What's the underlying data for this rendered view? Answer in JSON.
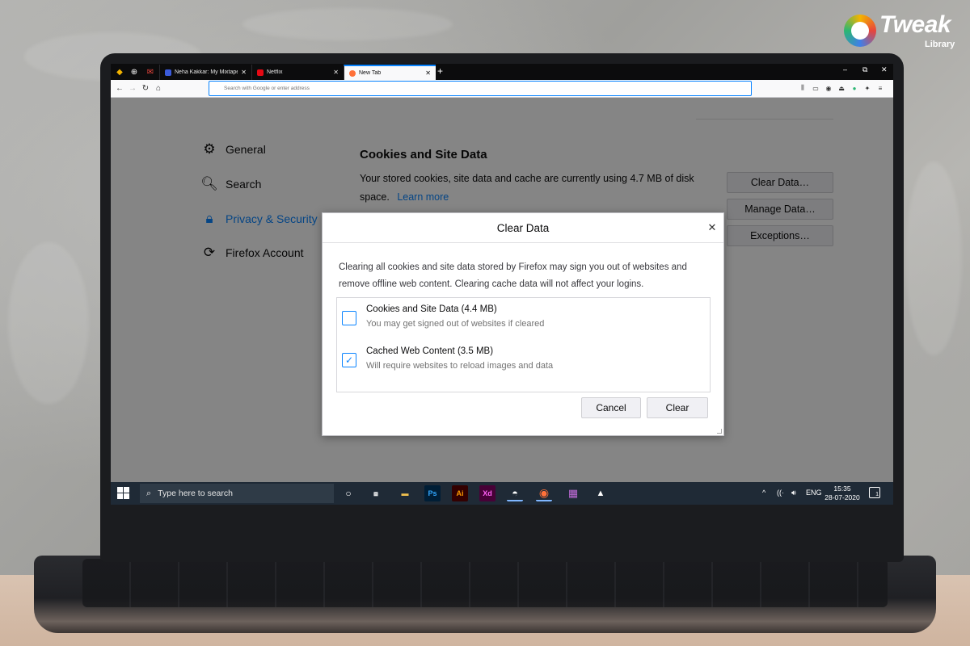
{
  "brand": {
    "name": "Tweak",
    "sub": "Library"
  },
  "browser": {
    "tabs": [
      {
        "label": "Neha Kakkar: My Mixtape on F",
        "favicon_color": "#3b5bdb",
        "close": "✕"
      },
      {
        "label": "Netflix",
        "favicon_color": "#e50914",
        "close": "✕"
      },
      {
        "label": "New Tab",
        "favicon_color": "#ff7139",
        "close": "✕",
        "active": true
      }
    ],
    "new_tab": "+",
    "window_controls": {
      "minimize": "–",
      "restore": "⧉",
      "close": "✕"
    },
    "url_placeholder": "Search with Google or enter address"
  },
  "settings": {
    "sidebar": [
      {
        "label": "General",
        "icon": "gear-icon",
        "glyph": "⚙"
      },
      {
        "label": "Search",
        "icon": "search-icon",
        "glyph": "🔍︎"
      },
      {
        "label": "Privacy & Security",
        "icon": "lock-icon",
        "glyph": "🔒︎",
        "selected": true
      },
      {
        "label": "Firefox Account",
        "icon": "sync-icon",
        "glyph": "⟳"
      }
    ],
    "section": {
      "title": "Cookies and Site Data",
      "description": "Your stored cookies, site data and cache are currently using 4.7 MB of disk space.",
      "learn_more": "Learn more"
    },
    "buttons": {
      "clear_data": "Clear Data…",
      "manage_data": "Manage Data…",
      "exceptions": "Exceptions…"
    }
  },
  "dialog": {
    "title": "Clear Data",
    "close": "✕",
    "description": "Clearing all cookies and site data stored by Firefox may sign you out of websites and remove offline web content. Clearing cache data will not affect your logins.",
    "options": [
      {
        "label": "Cookies and Site Data (4.4 MB)",
        "sub": "You may get signed out of websites if cleared",
        "checked": false,
        "mark": ""
      },
      {
        "label": "Cached Web Content (3.5 MB)",
        "sub": "Will require websites to reload images and data",
        "checked": true,
        "mark": "✓"
      }
    ],
    "cancel": "Cancel",
    "clear": "Clear"
  },
  "taskbar": {
    "search_placeholder": "Type here to search",
    "apps": [
      {
        "name": "file-explorer-icon",
        "glyph": "▬",
        "color": "#f2c14e"
      },
      {
        "name": "photoshop-icon",
        "glyph": "Ps",
        "color": "#31a8ff"
      },
      {
        "name": "illustrator-icon",
        "glyph": "Ai",
        "color": "#ff9a00"
      },
      {
        "name": "xd-icon",
        "glyph": "Xd",
        "color": "#ff61f6"
      },
      {
        "name": "snipping-tool-icon",
        "glyph": "◓",
        "color": "#ffffff",
        "active": true
      },
      {
        "name": "firefox-icon",
        "glyph": "◉",
        "color": "#ff7139",
        "active": true
      },
      {
        "name": "winrar-icon",
        "glyph": "▦",
        "color": "#c06bd8"
      },
      {
        "name": "photos-icon",
        "glyph": "▲",
        "color": "#ffffff"
      }
    ],
    "tray": {
      "chevron": "^",
      "network": "((·",
      "volume": "🔊︎",
      "language": "ENG"
    },
    "time": "15:35",
    "date": "28-07-2020",
    "notifications_count": "1"
  },
  "colors": {
    "accent": "#0a84ff",
    "taskbar": "#1f2a36"
  }
}
